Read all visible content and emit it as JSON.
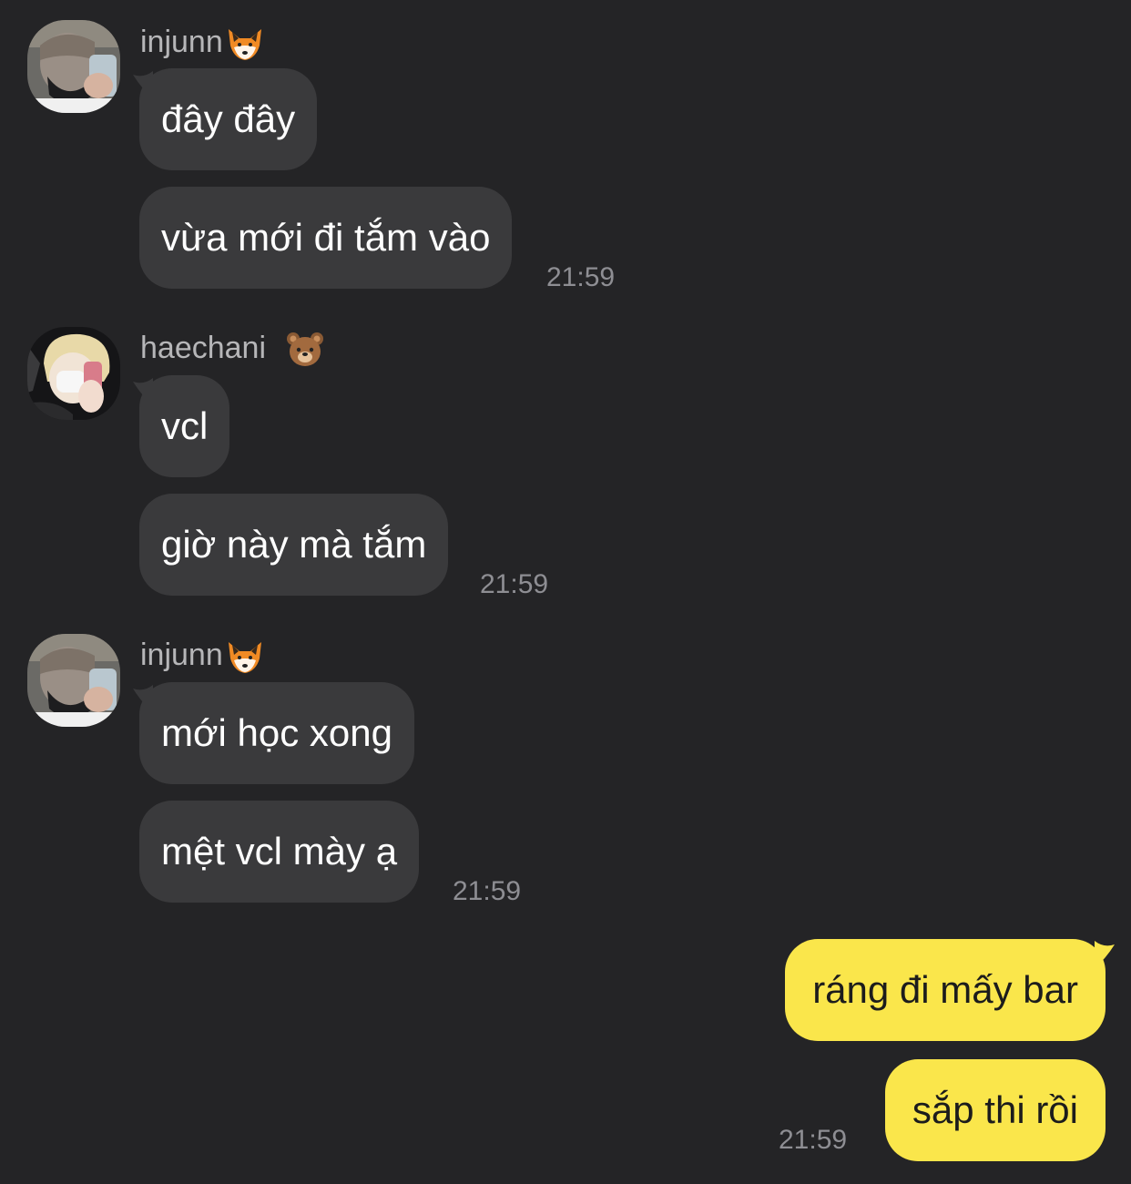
{
  "groups": [
    {
      "sender": "injunn",
      "sender_emoji": "fox-face-emoji",
      "messages": [
        "đây đây",
        "vừa mới đi tắm vào"
      ],
      "time": "21:59"
    },
    {
      "sender": "haechani ",
      "sender_emoji": "bear-face-emoji",
      "messages": [
        "vcl",
        "giờ này mà tắm"
      ],
      "time": "21:59"
    },
    {
      "sender": "injunn",
      "sender_emoji": "fox-face-emoji",
      "messages": [
        "mới học xong",
        "mệt vcl mày ạ"
      ],
      "time": "21:59"
    }
  ],
  "outgoing": {
    "messages": [
      "ráng đi mấy bar",
      "sắp thi rồi"
    ],
    "time": "21:59"
  },
  "colors": {
    "background": "#242426",
    "incoming_bubble": "#3a3a3c",
    "outgoing_bubble": "#fae64b",
    "sender_name": "#b6b6b8",
    "timestamp": "#8e8e93"
  }
}
